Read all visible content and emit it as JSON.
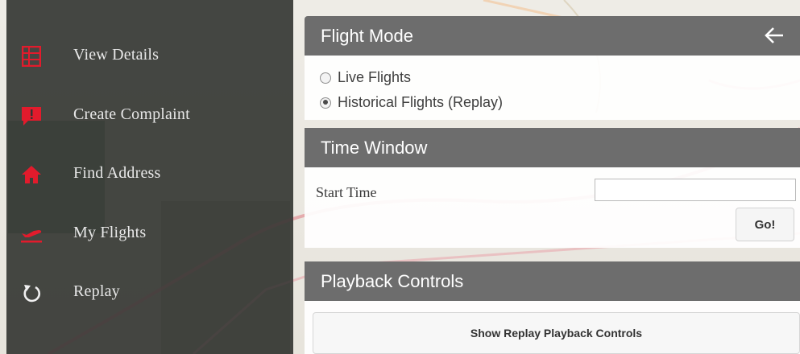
{
  "sidebar": {
    "items": [
      {
        "label": "View Details",
        "icon": "details-grid-icon"
      },
      {
        "label": "Create Complaint",
        "icon": "complaint-flag-icon"
      },
      {
        "label": "Find Address",
        "icon": "home-icon"
      },
      {
        "label": "My Flights",
        "icon": "airplane-icon"
      },
      {
        "label": "Replay",
        "icon": "replay-icon"
      }
    ]
  },
  "flight_mode": {
    "title": "Flight Mode",
    "options": [
      {
        "label": "Live Flights",
        "checked": false
      },
      {
        "label": "Historical Flights (Replay)",
        "checked": true
      }
    ]
  },
  "time_window": {
    "title": "Time Window",
    "start_label": "Start Time",
    "start_value": "",
    "go_label": "Go!"
  },
  "playback": {
    "title": "Playback Controls",
    "button_label": "Show Replay Playback Controls"
  },
  "colors": {
    "accent": "#e21b2c",
    "sidebar_bg": "#343434",
    "header_bg": "#6d6d6d"
  }
}
